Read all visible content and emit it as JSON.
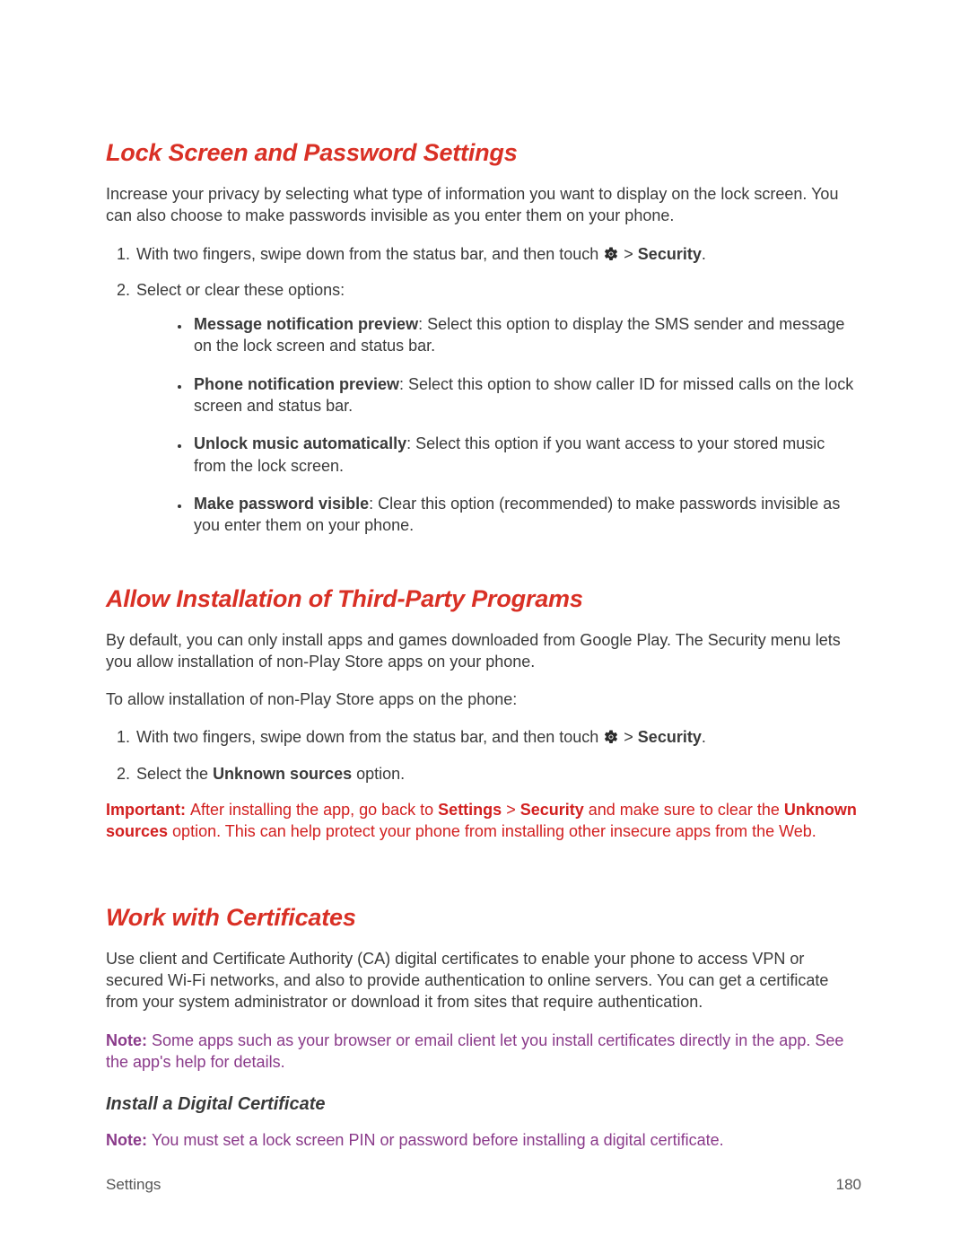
{
  "footer": {
    "section": "Settings",
    "page": "180"
  },
  "s1": {
    "title": "Lock Screen and Password Settings",
    "intro": "Increase your privacy by selecting what type of information you want to display on the lock screen. You can also choose to make passwords invisible as you enter them on your phone.",
    "step1_pre": "With two fingers, swipe down from the status bar, and then touch ",
    "step1_gt": " > ",
    "step1_security": "Security",
    "step1_post": ".",
    "step2": "Select or clear these options:",
    "opt1_label": "Message notification preview",
    "opt1_text": ": Select this option to display the SMS sender and message on the lock screen and status bar.",
    "opt2_label": "Phone notification preview",
    "opt2_text": ": Select this option to show caller ID for missed calls on the lock screen and status bar.",
    "opt3_label": "Unlock music automatically",
    "opt3_text": ": Select this option if you want access to your stored music from the lock screen.",
    "opt4_label": "Make password visible",
    "opt4_text": ": Clear this option (recommended) to make passwords invisible as you enter them on your phone."
  },
  "s2": {
    "title": "Allow Installation of Third-Party Programs",
    "intro": "By default, you can only install apps and games downloaded from Google Play. The Security menu lets you allow installation of non-Play Store apps on your phone.",
    "lead": "To allow installation of non-Play Store apps on the phone:",
    "step1_pre": "With two fingers, swipe down from the status bar, and then touch ",
    "step1_gt": " > ",
    "step1_security": "Security",
    "step1_post": ".",
    "step2_pre": "Select the ",
    "step2_bold": "Unknown sources",
    "step2_post": " option.",
    "imp_label": "Important: ",
    "imp_a": " After installing the app, go back to ",
    "imp_settings": "Settings",
    "imp_gt": " > ",
    "imp_security": "Security",
    "imp_b": " and make sure to clear the ",
    "imp_unknown": "Unknown sources",
    "imp_c": " option. This can help protect your phone from installing other insecure apps from the Web."
  },
  "s3": {
    "title": "Work with Certificates",
    "intro": "Use client and Certificate Authority (CA) digital certificates to enable your phone to access VPN or secured Wi-Fi networks, and also to provide authentication to online servers. You can get a certificate from your system administrator or download it from sites that require authentication.",
    "note1_label": "Note: ",
    "note1_text": " Some apps such as your browser or email client let you install certificates directly in the app. See the app's help for details.",
    "sub1": "Install a Digital Certificate",
    "note2_label": "Note: ",
    "note2_text": " You must set a lock screen PIN or password before installing a digital certificate."
  }
}
